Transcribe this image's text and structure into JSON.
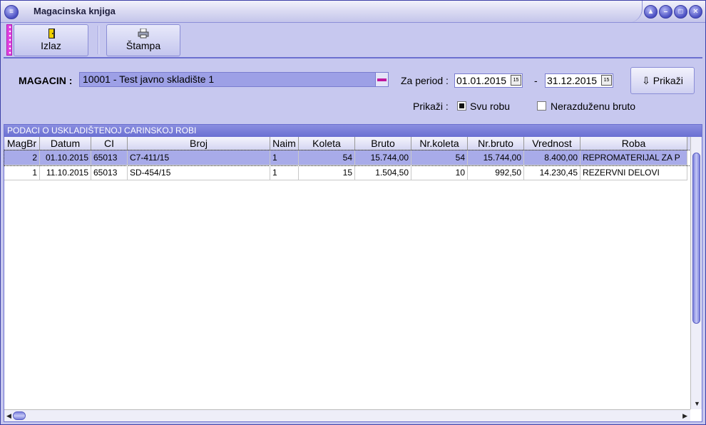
{
  "window": {
    "title": "Magacinska knjiga"
  },
  "toolbar": {
    "exit_label": "Izlaz",
    "print_label": "Štampa"
  },
  "filter": {
    "warehouse_label": "MAGACIN :",
    "warehouse_value": "10001 - Test javno skladište 1",
    "period_label": "Za period :",
    "date_from": "01.01.2015",
    "date_sep": "-",
    "date_to": "31.12.2015",
    "show_button": "Prikaži",
    "show_label": "Prikaži :",
    "option_all": "Svu robu",
    "option_unreleased": "Nerazduženu bruto",
    "option_all_checked": true,
    "option_unreleased_checked": false
  },
  "grid": {
    "caption": "PODACI O USKLADIŠTENOJ CARINSKOJ ROBI",
    "columns": [
      "MagBr",
      "Datum",
      "CI",
      "Broj",
      "Naim",
      "Koleta",
      "Bruto",
      "Nr.koleta",
      "Nr.bruto",
      "Vrednost",
      "Roba"
    ],
    "rows": [
      [
        "2",
        "01.10.2015",
        "65013",
        "C7-411/15",
        "1",
        "54",
        "15.744,00",
        "54",
        "15.744,00",
        "8.400,00",
        "REPROMATERIJAL ZA P"
      ],
      [
        "1",
        "11.10.2015",
        "65013",
        "SD-454/15",
        "1",
        "15",
        "1.504,50",
        "10",
        "992,50",
        "14.230,45",
        "REZERVNI DELOVI"
      ]
    ]
  },
  "colors": {
    "accent": "#5a5fc4",
    "selection": "#a8abe9",
    "panel": "#c7c8ef"
  },
  "icons": {
    "system_menu": "menu-icon",
    "exit": "door-icon",
    "print": "printer-icon",
    "calendar": "calendar-icon",
    "show": "arrow-down-icon"
  }
}
